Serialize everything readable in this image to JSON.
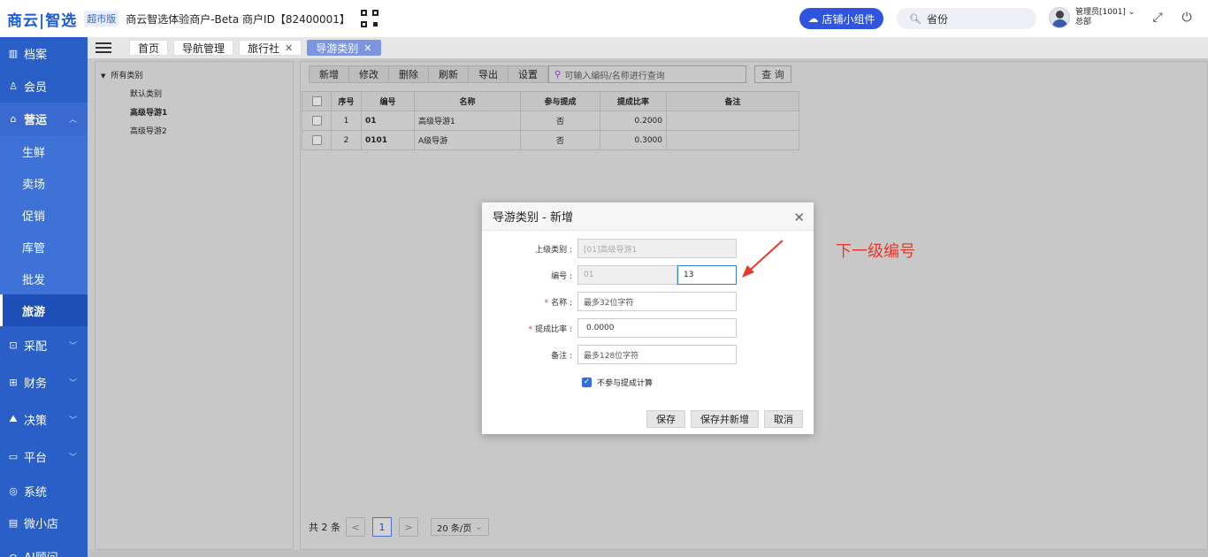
{
  "header": {
    "logo": "商云|智选",
    "edition": "超市版",
    "merchant": "商云智选体验商户-Beta  商户ID【82400001】",
    "shop_widget": "店铺小组件",
    "search_value": "省份",
    "user_name": "管理员[1001]",
    "user_org": "总部"
  },
  "sidebar": {
    "items": [
      {
        "label": "档案",
        "icon": "archive-icon"
      },
      {
        "label": "会员",
        "icon": "user-icon"
      },
      {
        "label": "营运",
        "icon": "store-icon"
      },
      {
        "label": "生鲜"
      },
      {
        "label": "卖场"
      },
      {
        "label": "促销"
      },
      {
        "label": "库管"
      },
      {
        "label": "批发"
      },
      {
        "label": "旅游"
      },
      {
        "label": "采配",
        "icon": "cart-icon"
      },
      {
        "label": "财务",
        "icon": "finance-icon"
      },
      {
        "label": "决策",
        "icon": "decision-icon"
      },
      {
        "label": "平台",
        "icon": "monitor-icon"
      },
      {
        "label": "系统",
        "icon": "settings-icon"
      },
      {
        "label": "微小店",
        "icon": "shop-icon"
      },
      {
        "label": "AI顾问",
        "icon": "ai-icon"
      }
    ]
  },
  "tabs": [
    {
      "label": "首页"
    },
    {
      "label": "导航管理"
    },
    {
      "label": "旅行社"
    },
    {
      "label": "导游类别"
    }
  ],
  "tree": {
    "root": "所有类别",
    "nodes": [
      "默认类别",
      "高级导游1",
      "高级导游2"
    ]
  },
  "toolbar": {
    "buttons": [
      "新增",
      "修改",
      "删除",
      "刷新",
      "导出",
      "设置"
    ],
    "search_placeholder": "可输入编码/名称进行查询",
    "query": "查 询"
  },
  "grid": {
    "headers": [
      "序号",
      "编号",
      "名称",
      "参与提成",
      "提成比率",
      "备注"
    ],
    "rows": [
      {
        "seq": "1",
        "code": "01",
        "name": "高级导游1",
        "commission": "否",
        "rate": "0.2000",
        "remark": ""
      },
      {
        "seq": "2",
        "code": "0101",
        "name": "A级导游",
        "commission": "否",
        "rate": "0.3000",
        "remark": ""
      }
    ]
  },
  "pager": {
    "total": "共 2 条",
    "prev": "<",
    "current": "1",
    "next": ">",
    "page_size": "20 条/页"
  },
  "modal": {
    "title": "导游类别 - 新增",
    "parent_label": "上级类别 :",
    "parent_value": "[01]高级导游1",
    "code_label": "编号 :",
    "code_prefix": "01",
    "code_value": "13",
    "name_label": "名称 :",
    "name_placeholder": "最多32位字符",
    "rate_label": "提成比率 :",
    "rate_value": "0.0000",
    "remark_label": "备注 :",
    "remark_placeholder": "最多128位字符",
    "checkbox_label": "不参与提成计算",
    "save": "保存",
    "save_new": "保存并新增",
    "cancel": "取消"
  },
  "annotation": "下一级编号",
  "colors": {
    "sidebar": "#2b5fc8",
    "accent": "#2f55e0",
    "annotation": "#e53a2c"
  }
}
